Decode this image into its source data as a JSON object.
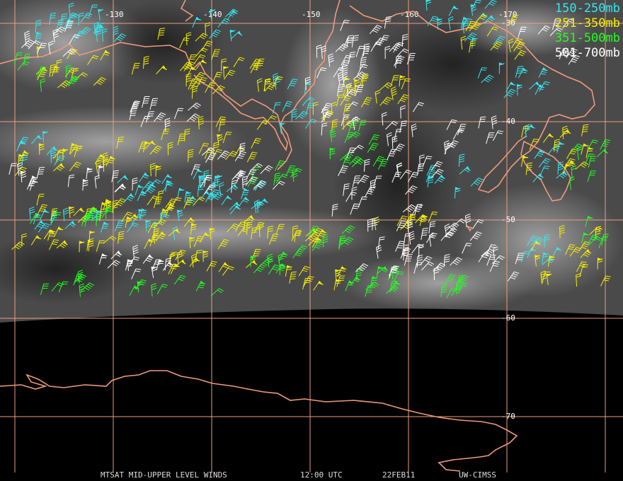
{
  "legend": [
    {
      "label": "150-250mb",
      "color": "#33e8f0"
    },
    {
      "label": "251-350mb",
      "color": "#f5f000"
    },
    {
      "label": "351-500mb",
      "color": "#22ff22"
    },
    {
      "label": "501-700mb",
      "color": "#ffffff"
    }
  ],
  "lon_labels": [
    "-130",
    "-140",
    "-150",
    "-160",
    "-170"
  ],
  "lat_labels": [
    "-30",
    "-40",
    "-50",
    "-60",
    "-70"
  ],
  "caption": {
    "product": "MTSAT MID-UPPER LEVEL WINDS",
    "time": "12:00 UTC",
    "date": "22FEB11",
    "source": "UW-CIMSS"
  },
  "colors": {
    "grid": "#e8a080",
    "coastline": "#f09a7a",
    "space": "#000000",
    "cloud_base": "#4a4a4a"
  }
}
